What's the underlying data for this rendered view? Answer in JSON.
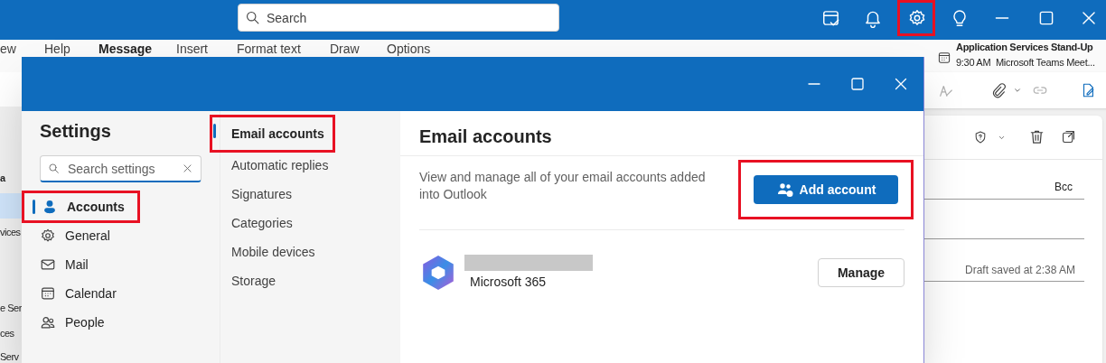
{
  "app_bar": {
    "search": {
      "placeholder": "Search"
    },
    "settings_highlighted": true
  },
  "ribbon_tabs": [
    {
      "label": "ew",
      "selected": false
    },
    {
      "label": "Help",
      "selected": false
    },
    {
      "label": "Message",
      "selected": true
    },
    {
      "label": "Insert",
      "selected": false
    },
    {
      "label": "Format text",
      "selected": false
    },
    {
      "label": "Draw",
      "selected": false
    },
    {
      "label": "Options",
      "selected": false
    }
  ],
  "reminder": {
    "title": "Application Services Stand-Up",
    "time": "9:30 AM",
    "subject": "Microsoft Teams Meet..."
  },
  "folder_fragments": [
    {
      "label": "a",
      "selected": false
    },
    {
      "selected": true
    },
    {
      "label": "vices",
      "selected": false
    },
    {
      "label": "e Ser",
      "selected": false
    },
    {
      "label": "ces",
      "selected": false
    },
    {
      "label": "Serv",
      "selected": false
    }
  ],
  "compose": {
    "bcc": "Bcc",
    "draft_status": "Draft saved at 2:38 AM"
  },
  "settings": {
    "title": "Settings",
    "search": {
      "placeholder": "Search settings"
    },
    "categories": [
      {
        "label": "Accounts",
        "selected": true,
        "highlighted": true
      },
      {
        "label": "General",
        "selected": false,
        "highlighted": false
      },
      {
        "label": "Mail",
        "selected": false,
        "highlighted": false
      },
      {
        "label": "Calendar",
        "selected": false,
        "highlighted": false
      },
      {
        "label": "People",
        "selected": false,
        "highlighted": false
      }
    ],
    "subcategories": [
      {
        "label": "Email accounts",
        "selected": true,
        "highlighted": true
      },
      {
        "label": "Automatic replies",
        "selected": false,
        "highlighted": false
      },
      {
        "label": "Signatures",
        "selected": false,
        "highlighted": false
      },
      {
        "label": "Categories",
        "selected": false,
        "highlighted": false
      },
      {
        "label": "Mobile devices",
        "selected": false,
        "highlighted": false
      },
      {
        "label": "Storage",
        "selected": false,
        "highlighted": false
      }
    ],
    "panel": {
      "title": "Email accounts",
      "description": "View and manage all of your email accounts added into Outlook",
      "add_button": {
        "label": "Add account",
        "highlighted": true
      },
      "accounts": [
        {
          "service": "Microsoft 365",
          "button": "Manage"
        }
      ]
    }
  }
}
